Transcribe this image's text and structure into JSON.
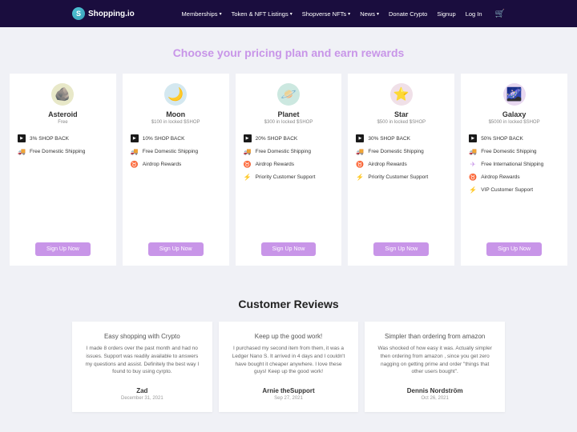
{
  "header": {
    "logo": "Shopping.io",
    "nav": [
      "Memberships",
      "Token & NFT Listings",
      "Shopverse NFTs",
      "News",
      "Donate Crypto",
      "Signup",
      "Log In"
    ],
    "nav_caret": [
      true,
      true,
      true,
      true,
      false,
      false,
      false
    ]
  },
  "pricing_title": "Choose your pricing plan and earn rewards",
  "plans": [
    {
      "name": "Asteroid",
      "price": "Free",
      "icon": "🪨",
      "icon_class": "asteroid",
      "features": [
        {
          "icon": "shop",
          "text": "3% SHOP BACK"
        },
        {
          "icon": "ship",
          "text": "Free Domestic Shipping"
        }
      ]
    },
    {
      "name": "Moon",
      "price": "$100 in locked $SHOP",
      "icon": "🌙",
      "icon_class": "moon",
      "features": [
        {
          "icon": "shop",
          "text": "10% SHOP BACK"
        },
        {
          "icon": "ship",
          "text": "Free Domestic Shipping"
        },
        {
          "icon": "airdrop",
          "text": "Airdrop Rewards"
        }
      ]
    },
    {
      "name": "Planet",
      "price": "$300 in locked $SHOP",
      "icon": "🪐",
      "icon_class": "planet",
      "features": [
        {
          "icon": "shop",
          "text": "20% SHOP BACK"
        },
        {
          "icon": "ship",
          "text": "Free Domestic Shipping"
        },
        {
          "icon": "airdrop",
          "text": "Airdrop Rewards"
        },
        {
          "icon": "priority",
          "text": "Priority Customer Support"
        }
      ]
    },
    {
      "name": "Star",
      "price": "$500 in locked $SHOP",
      "icon": "⭐",
      "icon_class": "star",
      "features": [
        {
          "icon": "shop",
          "text": "30% SHOP BACK"
        },
        {
          "icon": "ship",
          "text": "Free Domestic Shipping"
        },
        {
          "icon": "airdrop",
          "text": "Airdrop Rewards"
        },
        {
          "icon": "priority",
          "text": "Priority Customer Support"
        }
      ]
    },
    {
      "name": "Galaxy",
      "price": "$5000 in locked $SHOP",
      "icon": "🌌",
      "icon_class": "galaxy",
      "features": [
        {
          "icon": "shop",
          "text": "50% SHOP BACK"
        },
        {
          "icon": "ship",
          "text": "Free Domestic Shipping"
        },
        {
          "icon": "intl",
          "text": "Free International Shipping"
        },
        {
          "icon": "airdrop",
          "text": "Airdrop Rewards"
        },
        {
          "icon": "priority",
          "text": "VIP Customer Support"
        }
      ]
    }
  ],
  "signup_label": "Sign Up Now",
  "reviews_title": "Customer Reviews",
  "reviews": [
    {
      "title": "Easy shopping with Crypto",
      "text": "I made 8 orders over the past month and had no issues. Support was readily available to answers my questions and assist. Definitely the best way I found to buy using cyrpto.",
      "author": "Zad",
      "date": "December 31, 2021"
    },
    {
      "title": "Keep up the good work!",
      "text": "I purchased my second item from them, it was a Ledger Nano S. It arrived in 4 days and I couldn't have bought it cheaper anywhere. I love these guys! Keep up the good work!",
      "author": "Arnie theSupport",
      "date": "Sep 27, 2021"
    },
    {
      "title": "Simpler than ordering from amazon",
      "text": "Was shocked of how easy it was. Actually simpler then ordering from amazon , since you get zero nagging on getting prime and order \"things that other users bought\".",
      "author": "Dennis Nordström",
      "date": "Oct 26, 2021"
    }
  ],
  "feature_icons": {
    "shop": "▶",
    "ship": "🚚",
    "airdrop": "♉",
    "priority": "⚡",
    "intl": "✈"
  }
}
